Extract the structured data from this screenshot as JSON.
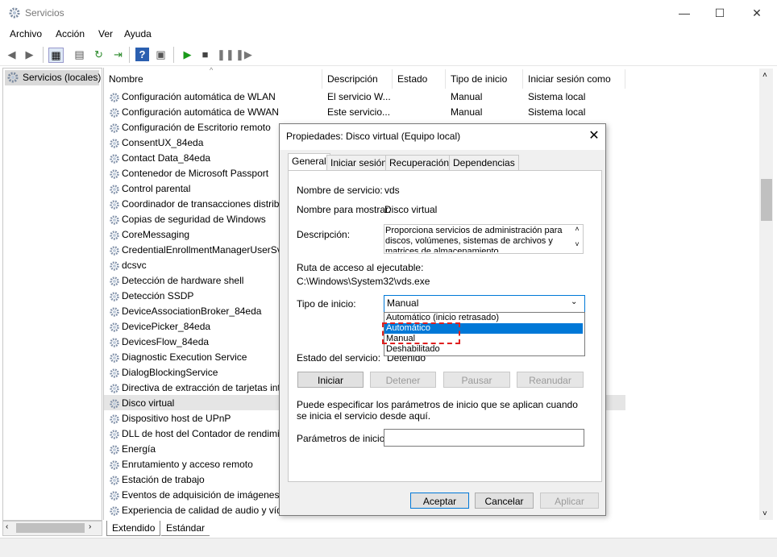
{
  "window": {
    "title": "Servicios",
    "minimize": "—",
    "maximize": "☐",
    "close": "✕"
  },
  "menu": [
    "Archivo",
    "Acción",
    "Ver",
    "Ayuda"
  ],
  "left_pane": {
    "item": "Servicios (locales)"
  },
  "columns": {
    "name": "Nombre",
    "description": "Descripción",
    "status": "Estado",
    "startup": "Tipo de inicio",
    "logon": "Iniciar sesión como"
  },
  "services": [
    {
      "name": "Configuración automática de WLAN",
      "description": "El servicio W...",
      "startup": "Manual",
      "logon": "Sistema local"
    },
    {
      "name": "Configuración automática de WWAN",
      "description": "Este servicio...",
      "startup": "Manual",
      "logon": "Sistema local"
    },
    {
      "name": "Configuración de Escritorio remoto"
    },
    {
      "name": "ConsentUX_84eda"
    },
    {
      "name": "Contact Data_84eda"
    },
    {
      "name": "Contenedor de Microsoft Passport"
    },
    {
      "name": "Control parental"
    },
    {
      "name": "Coordinador de transacciones distrib"
    },
    {
      "name": "Copias de seguridad de Windows"
    },
    {
      "name": "CoreMessaging"
    },
    {
      "name": "CredentialEnrollmentManagerUserSvc"
    },
    {
      "name": "dcsvc"
    },
    {
      "name": "Detección de hardware shell"
    },
    {
      "name": "Detección SSDP"
    },
    {
      "name": "DeviceAssociationBroker_84eda"
    },
    {
      "name": "DevicePicker_84eda"
    },
    {
      "name": "DevicesFlow_84eda"
    },
    {
      "name": "Diagnostic Execution Service"
    },
    {
      "name": "DialogBlockingService"
    },
    {
      "name": "Directiva de extracción de tarjetas inte"
    },
    {
      "name": "Disco virtual"
    },
    {
      "name": "Dispositivo host de UPnP"
    },
    {
      "name": "DLL de host del Contador de rendimie"
    },
    {
      "name": "Energía"
    },
    {
      "name": "Enrutamiento y acceso remoto"
    },
    {
      "name": "Estación de trabajo"
    },
    {
      "name": "Eventos de adquisición de imágenes"
    },
    {
      "name": "Experiencia de calidad de audio y víde"
    }
  ],
  "bottom_tabs": [
    "Extendido",
    "Estándar"
  ],
  "dialog": {
    "title": "Propiedades: Disco virtual (Equipo local)",
    "tabs": [
      "General",
      "Iniciar sesión",
      "Recuperación",
      "Dependencias"
    ],
    "service_name_label": "Nombre de servicio:",
    "service_name": "vds",
    "display_name_label": "Nombre para mostrar:",
    "display_name": "Disco virtual",
    "description_label": "Descripción:",
    "description": "Proporciona servicios de administración para discos, volúmenes, sistemas de archivos y matrices de almacenamiento.",
    "path_label": "Ruta de acceso al ejecutable:",
    "path": "C:\\Windows\\System32\\vds.exe",
    "startup_label": "Tipo de inicio:",
    "startup_value": "Manual",
    "startup_options": [
      "Automático (inicio retrasado)",
      "Automático",
      "Manual",
      "Deshabilitado"
    ],
    "status_label": "Estado del servicio:",
    "status_value": "Detenido",
    "buttons": {
      "start": "Iniciar",
      "stop": "Detener",
      "pause": "Pausar",
      "resume": "Reanudar"
    },
    "hint": "Puede especificar los parámetros de inicio que se aplican cuando se inicia el servicio desde aquí.",
    "params_label": "Parámetros de inicio:",
    "params_value": "",
    "footer": {
      "ok": "Aceptar",
      "cancel": "Cancelar",
      "apply": "Aplicar"
    }
  }
}
